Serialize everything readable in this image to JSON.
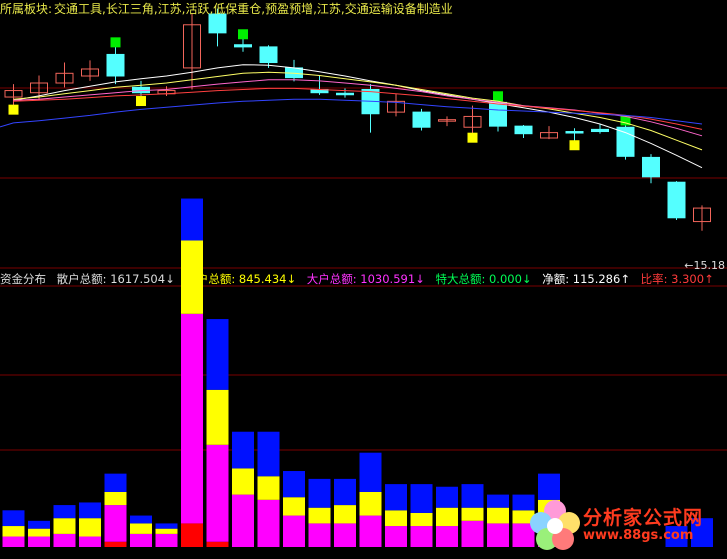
{
  "info": {
    "label": "所属板块:",
    "sectors": "交通工具,长江三角,江苏,活跃,低保重仓,预盈预增,江苏,交通运输设备制造业"
  },
  "indicator_header": {
    "title": "资金分布",
    "retail_label": "散户总额:",
    "retail_value": "1617.504",
    "retail_arrow": "↓",
    "mid_label": "中户总额:",
    "mid_value": "845.434",
    "mid_arrow": "↓",
    "large_label": "大户总额:",
    "large_value": "1030.591",
    "large_arrow": "↓",
    "super_label": "特大总额:",
    "super_value": "0.000",
    "super_arrow": "↓",
    "net_label": "净额:",
    "net_value": "115.286",
    "net_arrow": "↑",
    "ratio_label": "比率:",
    "ratio_value": "3.300",
    "ratio_arrow": "↑"
  },
  "last_price_label": "←15.18",
  "watermark": {
    "brand": "分析家公式网",
    "url": "www.88gs.com"
  },
  "colors": {
    "background": "#000000",
    "up_candle": "#f2655a",
    "down_candle": "#54ffff",
    "yellow_box": "#ffff00",
    "green_box": "#00ee00",
    "ma_white": "#ffffff",
    "ma_yellow": "#ffff66",
    "ma_pink": "#ff66cc",
    "ma_red": "#ff4040",
    "ma_blue": "#3344ff",
    "bar_blue": "#0011ff",
    "bar_yellow": "#ffff00",
    "bar_magenta": "#ff00ff",
    "bar_red": "#ff0000",
    "gridline": "#7a0000",
    "retail_color": "#dddddd",
    "mid_color": "#ffff00",
    "large_color": "#ff33ff",
    "super_color": "#00ff55",
    "net_color": "#ffffff",
    "ratio_color": "#ff3b3b"
  },
  "chart_data": [
    {
      "type": "candlestick",
      "title": "",
      "ylim": [
        14.6,
        19.2
      ],
      "candles": [
        {
          "o": 17.66,
          "c": 17.78,
          "h": 17.9,
          "l": 17.5,
          "marker": "yellow"
        },
        {
          "o": 17.74,
          "c": 17.92,
          "h": 18.06,
          "l": 17.6,
          "marker": ""
        },
        {
          "o": 17.92,
          "c": 18.1,
          "h": 18.3,
          "l": 17.84,
          "marker": ""
        },
        {
          "o": 18.05,
          "c": 18.18,
          "h": 18.34,
          "l": 17.96,
          "marker": ""
        },
        {
          "o": 18.45,
          "c": 18.05,
          "h": 18.6,
          "l": 17.9,
          "marker": "green"
        },
        {
          "o": 17.84,
          "c": 17.74,
          "h": 17.96,
          "l": 17.66,
          "marker": "yellow"
        },
        {
          "o": 17.72,
          "c": 17.78,
          "h": 17.86,
          "l": 17.68,
          "marker": ""
        },
        {
          "o": 18.2,
          "c": 19.0,
          "h": 19.2,
          "l": 17.8,
          "marker": ""
        },
        {
          "o": 19.2,
          "c": 18.85,
          "h": 19.3,
          "l": 18.6,
          "marker": ""
        },
        {
          "o": 18.63,
          "c": 18.59,
          "h": 18.75,
          "l": 18.5,
          "marker": "green"
        },
        {
          "o": 18.59,
          "c": 18.3,
          "h": 18.62,
          "l": 18.2,
          "marker": ""
        },
        {
          "o": 18.2,
          "c": 18.02,
          "h": 18.35,
          "l": 17.95,
          "marker": ""
        },
        {
          "o": 17.8,
          "c": 17.74,
          "h": 18.05,
          "l": 17.7,
          "marker": ""
        },
        {
          "o": 17.73,
          "c": 17.71,
          "h": 17.82,
          "l": 17.65,
          "marker": ""
        },
        {
          "o": 17.8,
          "c": 17.35,
          "h": 17.9,
          "l": 17.0,
          "marker": ""
        },
        {
          "o": 17.38,
          "c": 17.58,
          "h": 17.72,
          "l": 17.3,
          "marker": ""
        },
        {
          "o": 17.38,
          "c": 17.1,
          "h": 17.44,
          "l": 17.04,
          "marker": ""
        },
        {
          "o": 17.22,
          "c": 17.24,
          "h": 17.3,
          "l": 17.12,
          "marker": ""
        },
        {
          "o": 17.1,
          "c": 17.3,
          "h": 17.5,
          "l": 16.98,
          "marker": "yellow"
        },
        {
          "o": 17.56,
          "c": 17.12,
          "h": 17.6,
          "l": 17.02,
          "marker": "green"
        },
        {
          "o": 17.12,
          "c": 16.98,
          "h": 17.14,
          "l": 16.9,
          "marker": ""
        },
        {
          "o": 16.9,
          "c": 17.0,
          "h": 17.12,
          "l": 16.88,
          "marker": ""
        },
        {
          "o": 17.02,
          "c": 17.01,
          "h": 17.08,
          "l": 16.84,
          "marker": "yellow"
        },
        {
          "o": 17.06,
          "c": 17.02,
          "h": 17.15,
          "l": 16.98,
          "marker": ""
        },
        {
          "o": 17.1,
          "c": 16.56,
          "h": 17.15,
          "l": 16.5,
          "marker": "green"
        },
        {
          "o": 16.54,
          "c": 16.18,
          "h": 16.6,
          "l": 16.06,
          "marker": ""
        },
        {
          "o": 16.08,
          "c": 15.42,
          "h": 16.1,
          "l": 15.38,
          "marker": ""
        },
        {
          "o": 15.35,
          "c": 15.6,
          "h": 15.65,
          "l": 15.18,
          "marker": ""
        }
      ],
      "moving_averages": [
        {
          "color": "ma_white",
          "values": [
            17.6,
            17.68,
            17.78,
            17.86,
            17.94,
            18.0,
            18.05,
            18.12,
            18.2,
            18.26,
            18.25,
            18.2,
            18.13,
            18.05,
            17.96,
            17.88,
            17.78,
            17.7,
            17.62,
            17.54,
            17.46,
            17.38,
            17.28,
            17.16,
            17.0,
            16.8,
            16.58,
            16.35
          ]
        },
        {
          "color": "ma_yellow",
          "values": [
            17.62,
            17.66,
            17.72,
            17.78,
            17.84,
            17.88,
            17.92,
            17.98,
            18.04,
            18.1,
            18.12,
            18.1,
            18.06,
            18.0,
            17.94,
            17.88,
            17.8,
            17.72,
            17.64,
            17.58,
            17.5,
            17.44,
            17.36,
            17.28,
            17.18,
            17.04,
            16.86,
            16.68
          ]
        },
        {
          "color": "ma_pink",
          "values": [
            17.6,
            17.62,
            17.66,
            17.7,
            17.74,
            17.78,
            17.8,
            17.85,
            17.9,
            17.94,
            17.98,
            17.98,
            17.96,
            17.92,
            17.88,
            17.82,
            17.76,
            17.68,
            17.62,
            17.56,
            17.5,
            17.46,
            17.42,
            17.36,
            17.3,
            17.2,
            17.08,
            16.94
          ]
        },
        {
          "color": "ma_red",
          "values": [
            17.58,
            17.6,
            17.62,
            17.65,
            17.68,
            17.7,
            17.72,
            17.75,
            17.78,
            17.8,
            17.82,
            17.82,
            17.8,
            17.78,
            17.76,
            17.72,
            17.68,
            17.63,
            17.58,
            17.53,
            17.49,
            17.45,
            17.41,
            17.37,
            17.32,
            17.25,
            17.16,
            17.06
          ]
        },
        {
          "color": "ma_blue",
          "values": [
            17.18,
            17.22,
            17.27,
            17.32,
            17.38,
            17.43,
            17.47,
            17.51,
            17.55,
            17.58,
            17.6,
            17.62,
            17.62,
            17.6,
            17.58,
            17.56,
            17.52,
            17.48,
            17.45,
            17.42,
            17.4,
            17.38,
            17.36,
            17.34,
            17.32,
            17.28,
            17.22,
            17.16
          ]
        }
      ]
    },
    {
      "type": "stacked_bar",
      "title": "资金分布",
      "ylim": [
        0,
        100
      ],
      "series": [
        {
          "name": "特大总额",
          "color": "bar_red",
          "values": [
            0,
            0,
            0,
            0,
            2,
            0,
            0,
            9,
            2,
            0,
            0,
            0,
            0,
            0,
            0,
            0,
            0,
            0,
            0,
            0,
            0,
            0,
            0,
            0,
            0,
            0,
            0,
            0
          ]
        },
        {
          "name": "大户总额",
          "color": "bar_magenta",
          "values": [
            4,
            4,
            5,
            4,
            14,
            5,
            5,
            80,
            37,
            20,
            18,
            12,
            9,
            9,
            12,
            8,
            8,
            8,
            10,
            9,
            9,
            12,
            0,
            0,
            0,
            0,
            0,
            0
          ]
        },
        {
          "name": "中户总额",
          "color": "bar_yellow",
          "values": [
            4,
            3,
            6,
            7,
            5,
            4,
            2,
            28,
            21,
            10,
            9,
            7,
            6,
            7,
            9,
            6,
            5,
            7,
            5,
            6,
            5,
            6,
            0,
            0,
            0,
            0,
            0,
            0
          ]
        },
        {
          "name": "散户总额",
          "color": "bar_blue",
          "values": [
            6,
            3,
            5,
            6,
            7,
            3,
            2,
            16,
            27,
            14,
            17,
            10,
            11,
            10,
            15,
            10,
            11,
            8,
            9,
            5,
            6,
            10,
            0,
            0,
            0,
            0,
            8,
            11
          ]
        }
      ]
    }
  ]
}
